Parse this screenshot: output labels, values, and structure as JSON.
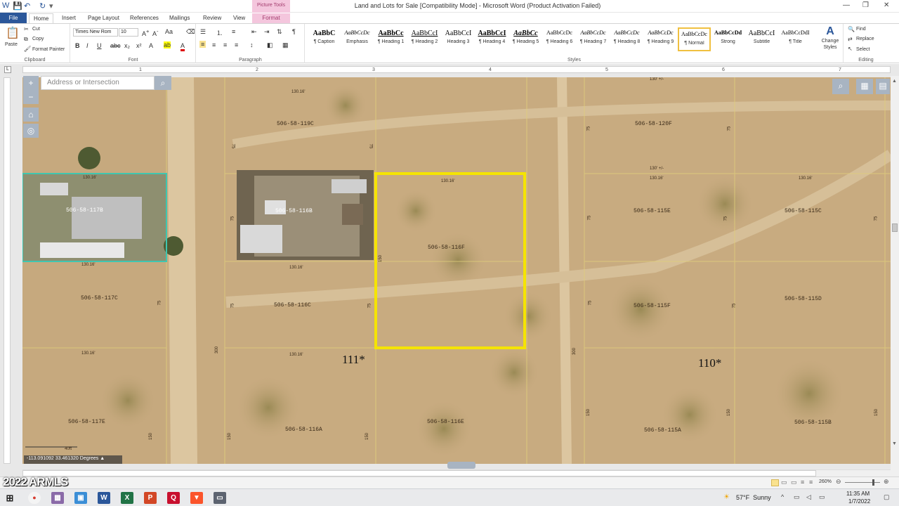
{
  "window": {
    "title": "Land and Lots for Sale [Compatibility Mode] - Microsoft Word (Product Activation Failed)",
    "picture_tools": "Picture Tools",
    "minimize": "—",
    "maximize": "❐",
    "close": "✕"
  },
  "tabs": [
    "File",
    "Home",
    "Insert",
    "Page Layout",
    "References",
    "Mailings",
    "Review",
    "View",
    "Format"
  ],
  "ribbon": {
    "clipboard": {
      "label": "Clipboard",
      "paste": "Paste",
      "cut": "Cut",
      "copy": "Copy",
      "format_painter": "Format Painter"
    },
    "font": {
      "label": "Font",
      "family": "Times New Rom",
      "size": "10"
    },
    "paragraph": {
      "label": "Paragraph"
    },
    "styles": {
      "label": "Styles",
      "items": [
        {
          "preview": "AaBbC",
          "name": "¶ Caption"
        },
        {
          "preview": "AaBbCcDc",
          "name": "Emphasis"
        },
        {
          "preview": "AaBbCc",
          "name": "¶ Heading 1"
        },
        {
          "preview": "AaBbCcI",
          "name": "¶ Heading 2"
        },
        {
          "preview": "AaBbCcI",
          "name": "Heading 3"
        },
        {
          "preview": "AaBbCcI",
          "name": "¶ Heading 4"
        },
        {
          "preview": "AaBbCc",
          "name": "¶ Heading 5"
        },
        {
          "preview": "AaBbCcDc",
          "name": "¶ Heading 6"
        },
        {
          "preview": "AaBbCcDc",
          "name": "¶ Heading 7"
        },
        {
          "preview": "AaBbCcDc",
          "name": "¶ Heading 8"
        },
        {
          "preview": "AaBbCcDc",
          "name": "¶ Heading 9"
        },
        {
          "preview": "AaBbCcDc",
          "name": "¶ Normal"
        },
        {
          "preview": "AaBbCcDd",
          "name": "Strong"
        },
        {
          "preview": "AaBbCcI",
          "name": "Subtitle"
        },
        {
          "preview": "AaBbCcDdI",
          "name": "¶ Title"
        }
      ],
      "change_styles": "Change Styles"
    },
    "editing": {
      "label": "Editing",
      "find": "Find",
      "replace": "Replace",
      "select": "Select"
    }
  },
  "ruler_numbers": [
    "1",
    "2",
    "3",
    "4",
    "5",
    "6",
    "7"
  ],
  "map": {
    "search_placeholder": "Address or Intersection",
    "coordinates": "-113.091092 33.461320 Degrees",
    "scale_label": "40ft",
    "parcels": [
      "506-58-119C",
      "506-58-120F",
      "506-58-117B",
      "506-58-116B",
      "506-58-116F",
      "506-58-115E",
      "506-58-115C",
      "506-58-117C",
      "506-58-116C",
      "506-58-115F",
      "506-58-115D",
      "506-58-117E",
      "506-58-116A",
      "506-58-116E",
      "506-58-115A",
      "506-58-115B"
    ],
    "blocks": [
      "111*",
      "110*"
    ],
    "dimensions": [
      "130.16'",
      "130' +/-",
      "75",
      "150",
      "300"
    ]
  },
  "status": {
    "zoom": "260%"
  },
  "watermark": "2022 ARMLS",
  "taskbar": {
    "weather": "57°F  Sunny",
    "time": "11:35 AM",
    "date": "1/7/2022"
  },
  "colors": {
    "word_blue": "#2b579a",
    "highlight": "#f5e400",
    "teal_outline": "#3fc6b0",
    "map_ground": "#c4a77c"
  }
}
